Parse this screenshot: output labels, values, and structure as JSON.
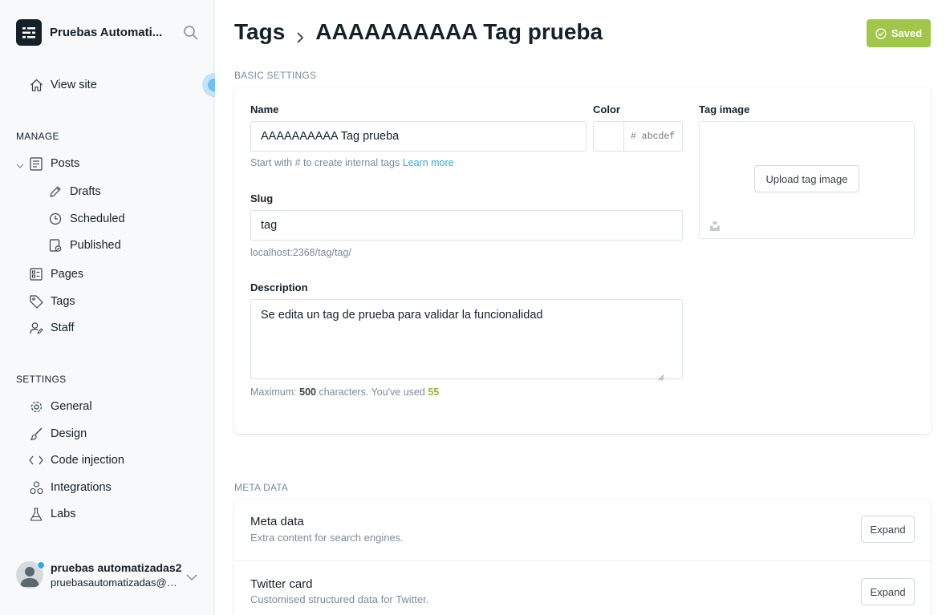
{
  "sidebar": {
    "site_name": "Pruebas Automati...",
    "view_site": "View site",
    "manage_heading": "MANAGE",
    "posts": "Posts",
    "drafts": "Drafts",
    "scheduled": "Scheduled",
    "published": "Published",
    "pages": "Pages",
    "tags": "Tags",
    "staff": "Staff",
    "settings_heading": "SETTINGS",
    "general": "General",
    "design": "Design",
    "code_injection": "Code injection",
    "integrations": "Integrations",
    "labs": "Labs",
    "account": {
      "name": "pruebas automatizadas2",
      "email": "pruebasautomatizadas@u..."
    }
  },
  "header": {
    "breadcrumb_parent": "Tags",
    "breadcrumb_current": "AAAAAAAAAA Tag prueba",
    "saved_label": "Saved"
  },
  "basic": {
    "section_label": "BASIC SETTINGS",
    "name_label": "Name",
    "name_value": "AAAAAAAAAA Tag prueba",
    "name_hint": "Start with # to create internal tags",
    "learn_more": "Learn more",
    "color_label": "Color",
    "color_placeholder": "# abcdef",
    "tag_image_label": "Tag image",
    "upload_label": "Upload tag image",
    "slug_label": "Slug",
    "slug_value": "tag",
    "slug_url": "localhost:2368/tag/tag/",
    "description_label": "Description",
    "description_value": "Se edita un tag de prueba para validar la funcionalidad",
    "desc_hint_prefix": "Maximum:",
    "desc_max": "500",
    "desc_hint_middle": "characters. You've used",
    "desc_used": "55"
  },
  "meta": {
    "section_label": "META DATA",
    "rows": [
      {
        "title": "Meta data",
        "subtitle": "Extra content for search engines.",
        "button": "Expand"
      },
      {
        "title": "Twitter card",
        "subtitle": "Customised structured data for Twitter.",
        "button": "Expand"
      }
    ]
  },
  "colors": {
    "saved_green": "#a1c74a",
    "link_blue": "#30a8e6",
    "count_green": "#8dba3c"
  }
}
